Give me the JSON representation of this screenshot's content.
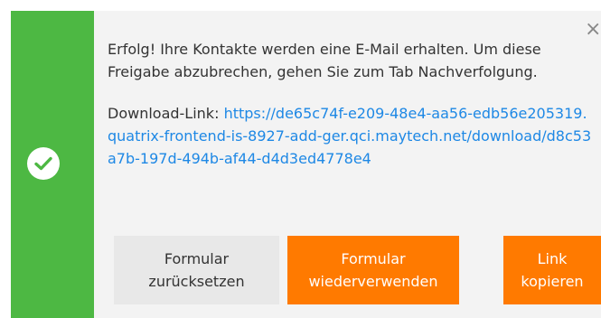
{
  "notification": {
    "message": "Erfolg! Ihre Kontakte werden eine E-Mail erhalten. Um diese Freigabe abzubrechen, gehen Sie zum Tab Nachverfolgung.",
    "link_label": "Download-Link:",
    "link_url": "https://de65c74f-e209-48e4-aa56-edb56e205319.quatrix-frontend-is-8927-add-ger.qci.maytech.net/download/d8c53a7b-197d-494b-af44-d4d3ed4778e4",
    "close_symbol": "×",
    "status_icon": "check-icon",
    "accent_color": "#4db843"
  },
  "buttons": {
    "reset_line1": "Formular",
    "reset_line2": "zurücksetzen",
    "reuse_line1": "Formular",
    "reuse_line2": "wiederverwenden",
    "copy_line1": "Link",
    "copy_line2": "kopieren",
    "primary_color": "#ff7a00"
  }
}
